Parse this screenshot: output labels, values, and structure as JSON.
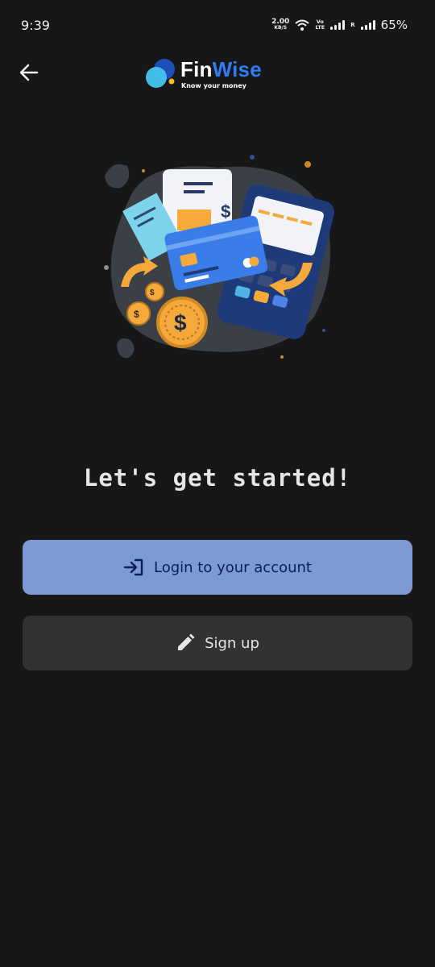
{
  "status_bar": {
    "time": "9:39",
    "net_speed_value": "2.00",
    "net_speed_unit": "KB/S",
    "volte_line1": "Vo",
    "volte_line2": "LTE",
    "roaming_label": "R",
    "battery": "65%"
  },
  "header": {
    "back_icon": "arrow-left-icon",
    "brand_name_part1": "Fin",
    "brand_name_part2": "Wise",
    "brand_tagline": "Know your money"
  },
  "main": {
    "heading": "Let's get started!",
    "login_label": "Login to your account",
    "login_icon": "login-icon",
    "signup_label": "Sign up",
    "signup_icon": "pencil-icon"
  },
  "colors": {
    "background": "#171717",
    "login_button": "#7e9ad6",
    "login_text": "#0c1f55",
    "signup_button": "#323232",
    "brand_blue": "#2d7df5"
  }
}
